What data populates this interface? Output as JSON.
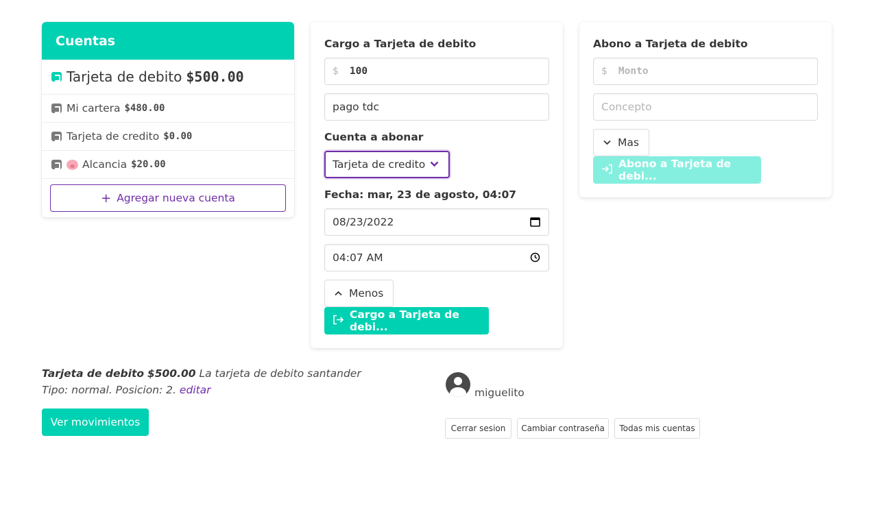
{
  "accounts": {
    "title": "Cuentas",
    "selected": {
      "name": "Tarjeta de debito",
      "amount": "$500.00",
      "icon": "wallet-icon"
    },
    "items": [
      {
        "name": "Mi cartera",
        "amount": "$480.00",
        "icon": "wallet-icon"
      },
      {
        "name": "Tarjeta de credito",
        "amount": "$0.00",
        "icon": "wallet-icon"
      },
      {
        "name": "Alcancia",
        "amount": "$20.00",
        "icon": "wallet-icon",
        "emoji": "pig-icon"
      }
    ],
    "add_label": "Agregar nueva cuenta",
    "accent": "#00d1b2"
  },
  "cargo": {
    "title": "Cargo a Tarjeta de debito",
    "amount_prefix": "$",
    "amount_value": "100",
    "concept_value": "pago tdc",
    "target_label": "Cuenta a abonar",
    "target_selected": "Tarjeta de credito",
    "date_label": "Fecha: mar, 23 de agosto, 04:07",
    "date_value": "08/23/2022",
    "time_value": "04:07 AM",
    "toggle_label": "Menos",
    "submit_label": "Cargo a Tarjeta de debi..."
  },
  "abono": {
    "title": "Abono a Tarjeta de debito",
    "amount_prefix": "$",
    "amount_placeholder": "Monto",
    "concept_placeholder": "Concepto",
    "toggle_label": "Mas",
    "submit_label": "Abono a Tarjeta de debi..."
  },
  "details": {
    "account_name": "Tarjeta de debito",
    "amount": "$500.00",
    "description": "La tarjeta de debito santander",
    "meta": "Tipo: normal. Posicion: 2.",
    "edit_label": "editar",
    "movements_label": "Ver movimientos"
  },
  "user": {
    "username": "miguelito",
    "logout_label": "Cerrar sesion",
    "change_password_label": "Cambiar contraseña",
    "all_accounts_label": "Todas mis cuentas"
  }
}
